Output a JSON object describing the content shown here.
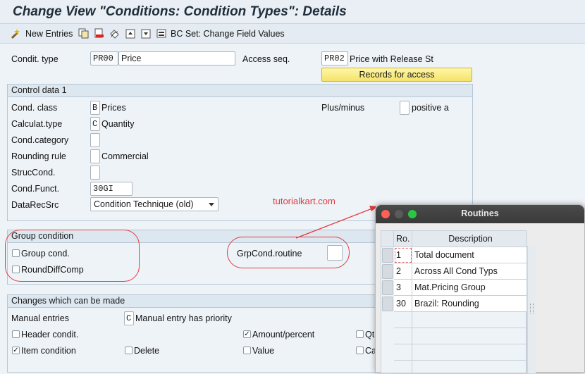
{
  "window": {
    "title": "Change View \"Conditions: Condition Types\": Details"
  },
  "toolbar": {
    "new_entries": "New Entries",
    "bc_set": "BC Set: Change Field Values"
  },
  "header": {
    "condit_type_label": "Condit. type",
    "condit_type_value": "PR00",
    "condit_type_desc": "Price",
    "access_seq_label": "Access seq.",
    "access_seq_value": "PR02",
    "access_seq_desc": "Price with Release St",
    "records_button": "Records for access"
  },
  "control_data": {
    "title": "Control data 1",
    "cond_class_label": "Cond. class",
    "cond_class_value": "B",
    "cond_class_desc": "Prices",
    "calc_type_label": "Calculat.type",
    "calc_type_value": "C",
    "calc_type_desc": "Quantity",
    "cond_category_label": "Cond.category",
    "rounding_label": "Rounding rule",
    "rounding_desc": "Commercial",
    "struc_label": "StrucCond.",
    "cond_funct_label": "Cond.Funct.",
    "cond_funct_value": "30GI",
    "datarec_label": "DataRecSrc",
    "datarec_value": "Condition Technique (old)",
    "plus_minus_label": "Plus/minus",
    "plus_minus_desc": "positive a"
  },
  "watermark": "tutorialkart.com",
  "group_condition": {
    "title": "Group condition",
    "group_cond_label": "Group cond.",
    "round_diff_label": "RoundDiffComp",
    "grpcond_routine_label": "GrpCond.routine"
  },
  "changes": {
    "title": "Changes which can be made",
    "manual_entries_label": "Manual entries",
    "manual_entries_value": "C",
    "manual_entries_desc": "Manual entry has priority",
    "header_condit_label": "Header condit.",
    "amount_percent_label": "Amount/percent",
    "amount_percent_checked": "✓",
    "qty_label": "Qt",
    "item_condition_label": "Item condition",
    "item_condition_checked": "✓",
    "delete_label": "Delete",
    "value_label": "Value",
    "calc_label": "Ca"
  },
  "routines_popup": {
    "title": "Routines",
    "col_ro": "Ro.",
    "col_desc": "Description",
    "rows": [
      {
        "ro": "1",
        "desc": "Total document"
      },
      {
        "ro": "2",
        "desc": "Across All Cond Typs"
      },
      {
        "ro": "3",
        "desc": "Mat.Pricing Group"
      },
      {
        "ro": "30",
        "desc": "Brazil: Rounding"
      }
    ]
  },
  "colors": {
    "annotation": "#e53a3a",
    "highlight_button": "#f5e36a"
  }
}
